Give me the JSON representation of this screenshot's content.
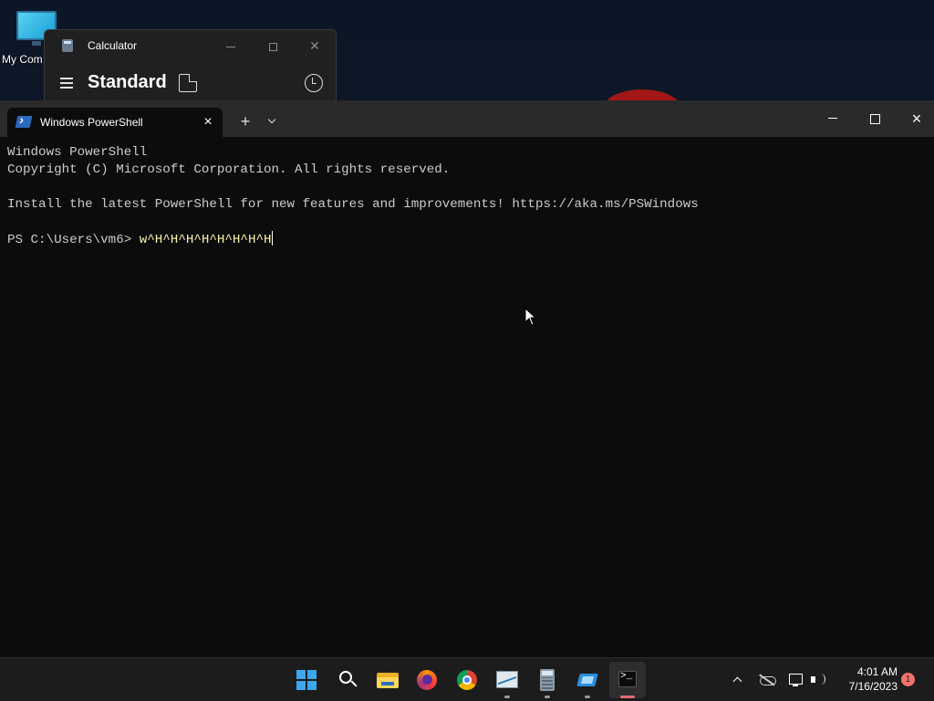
{
  "desktop": {
    "icons": [
      {
        "label": "My Com"
      }
    ]
  },
  "calculator": {
    "title": "Calculator",
    "mode": "Standard",
    "icons": [
      "calculator-app-icon",
      "menu-icon",
      "keep-on-top-icon",
      "history-icon"
    ]
  },
  "terminal": {
    "tab": {
      "title": "Windows PowerShell",
      "close": "×"
    },
    "new_tab": "+",
    "window_close": "×",
    "lines": [
      "Windows PowerShell",
      "Copyright (C) Microsoft Corporation. All rights reserved.",
      "",
      "Install the latest PowerShell for new features and improvements! https://aka.ms/PSWindows",
      ""
    ],
    "prompt": "PS C:\\Users\\vm6> ",
    "typed_input": "w^H^H^H^H^H^H^H^H"
  },
  "taskbar": {
    "apps": [
      {
        "name": "start",
        "icon": "windows-start-icon"
      },
      {
        "name": "search",
        "icon": "search-icon"
      },
      {
        "name": "file-explorer",
        "icon": "folder-icon"
      },
      {
        "name": "firefox",
        "icon": "firefox-icon"
      },
      {
        "name": "chrome",
        "icon": "chrome-icon"
      },
      {
        "name": "performance-monitor",
        "icon": "performance-monitor-icon"
      },
      {
        "name": "calculator",
        "icon": "calculator-icon"
      },
      {
        "name": "remote-desktop",
        "icon": "remote-desktop-icon"
      },
      {
        "name": "terminal",
        "icon": "terminal-icon"
      }
    ],
    "tray": {
      "time": "4:01 AM",
      "date": "7/16/2023",
      "notification_count": "1"
    }
  },
  "colors": {
    "terminal_bg": "#0c0c0c",
    "terminal_text": "#cccccc",
    "typed_text": "#f9f1a5",
    "accent_windows": "#3aa7ef",
    "notification_badge": "#f2736c"
  }
}
